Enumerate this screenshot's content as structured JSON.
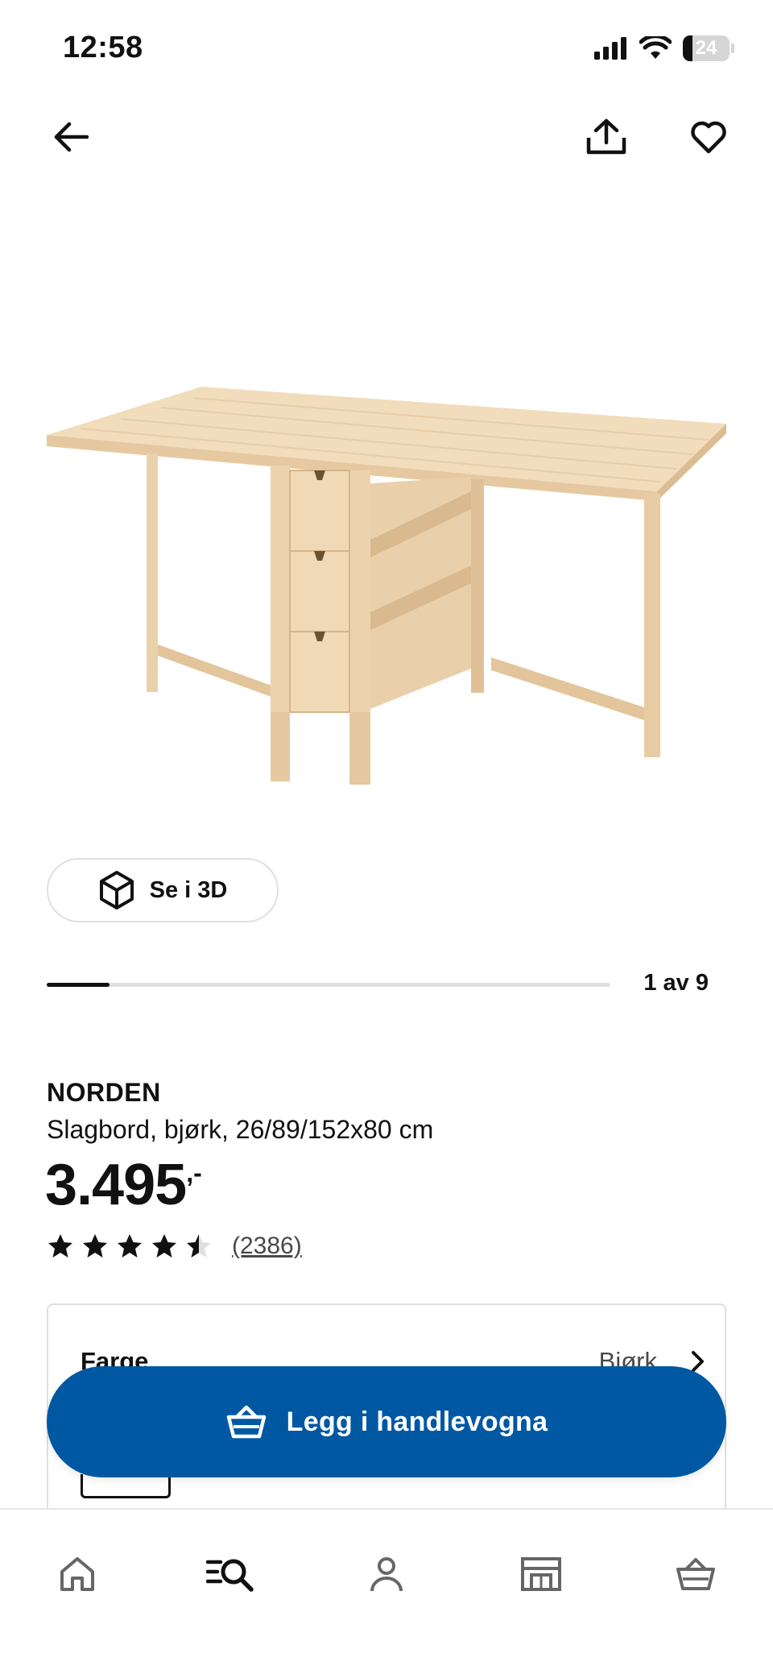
{
  "status_bar": {
    "time": "12:58",
    "battery": "24"
  },
  "nav": {
    "back_icon": "arrow-left-icon",
    "share_icon": "share-icon",
    "favorite_icon": "heart-icon"
  },
  "gallery": {
    "view3d_label": "Se i 3D",
    "pager": "1 av 9",
    "current": 1,
    "total": 9
  },
  "product": {
    "name": "NORDEN",
    "description": "Slagbord, bjørk, 26/89/152x80 cm",
    "price": "3.495",
    "price_suffix": ",-",
    "rating": 4.5,
    "reviews": "(2386)"
  },
  "options": {
    "color_label": "Farge",
    "color_value": "Bjørk"
  },
  "cart": {
    "button_label": "Legg i handlevogna"
  },
  "tabbar": {
    "items": [
      "home-icon",
      "search-icon",
      "profile-icon",
      "store-icon",
      "cart-icon"
    ],
    "active": "search-icon"
  },
  "colors": {
    "brand_blue": "#0058a3",
    "text": "#111111",
    "muted": "#484848",
    "border": "#dfdfdf",
    "wood_light": "#f1dcbc",
    "wood_mid": "#e6c9a0",
    "wood_dark": "#cfae82"
  }
}
